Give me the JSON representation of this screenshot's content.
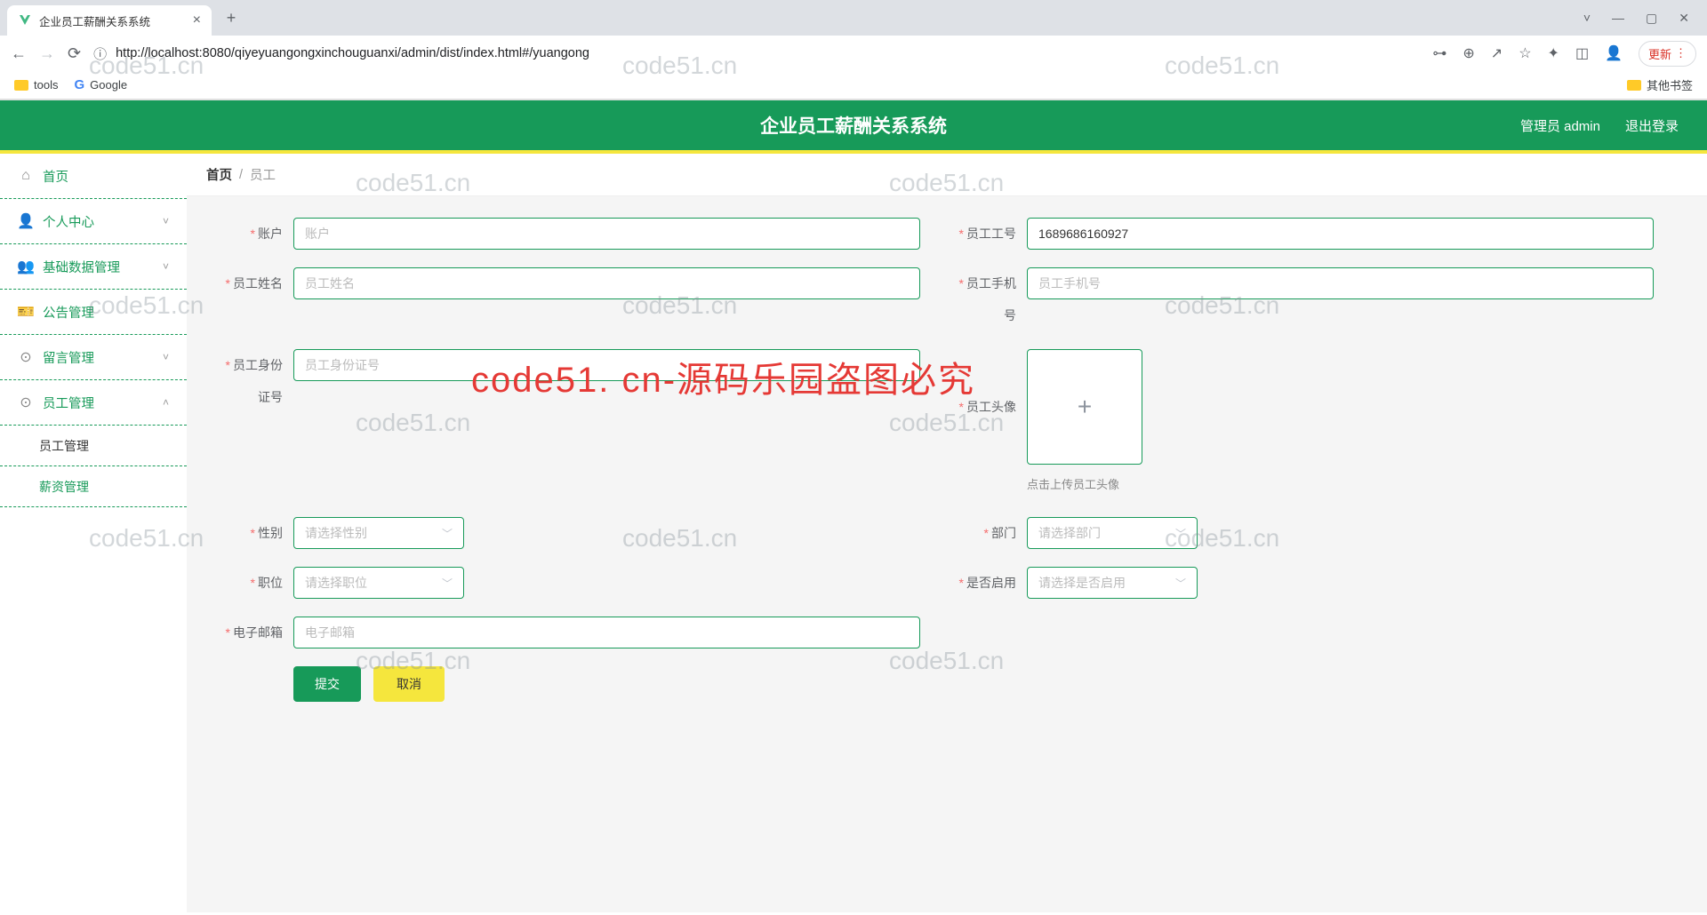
{
  "browser": {
    "tab_title": "企业员工薪酬关系系统",
    "url": "http://localhost:8080/qiyeyuangongxinchouguanxi/admin/dist/index.html#/yuangong",
    "update_label": "更新",
    "bookmarks": {
      "tools": "tools",
      "google": "Google",
      "other": "其他书签"
    }
  },
  "header": {
    "title": "企业员工薪酬关系系统",
    "admin_label": "管理员 admin",
    "logout": "退出登录"
  },
  "sidebar": {
    "items": [
      {
        "icon": "home",
        "label": "首页"
      },
      {
        "icon": "user",
        "label": "个人中心",
        "expand": "˅"
      },
      {
        "icon": "users",
        "label": "基础数据管理",
        "expand": "˅"
      },
      {
        "icon": "ticket",
        "label": "公告管理"
      },
      {
        "icon": "chat",
        "label": "留言管理",
        "expand": "˅"
      },
      {
        "icon": "gear",
        "label": "员工管理",
        "expand": "˄"
      }
    ],
    "sub": [
      {
        "label": "员工管理"
      },
      {
        "label": "薪资管理"
      }
    ]
  },
  "breadcrumb": {
    "home": "首页",
    "sep": "/",
    "current": "员工"
  },
  "form": {
    "account": {
      "label": "账户",
      "placeholder": "账户",
      "value": ""
    },
    "emp_no": {
      "label": "员工工号",
      "placeholder": "",
      "value": "1689686160927"
    },
    "emp_name": {
      "label": "员工姓名",
      "placeholder": "员工姓名",
      "value": ""
    },
    "phone": {
      "label": "员工手机号",
      "placeholder": "员工手机号",
      "value": ""
    },
    "idcard": {
      "label": "员工身份证号",
      "placeholder": "员工身份证号",
      "value": ""
    },
    "avatar": {
      "label": "员工头像",
      "hint": "点击上传员工头像"
    },
    "gender": {
      "label": "性别",
      "placeholder": "请选择性别"
    },
    "dept": {
      "label": "部门",
      "placeholder": "请选择部门"
    },
    "position": {
      "label": "职位",
      "placeholder": "请选择职位"
    },
    "enabled": {
      "label": "是否启用",
      "placeholder": "请选择是否启用"
    },
    "email": {
      "label": "电子邮箱",
      "placeholder": "电子邮箱",
      "value": ""
    },
    "submit": "提交",
    "cancel": "取消"
  },
  "watermarks": {
    "small": "code51.cn",
    "big": "code51. cn-源码乐园盗图必究"
  }
}
